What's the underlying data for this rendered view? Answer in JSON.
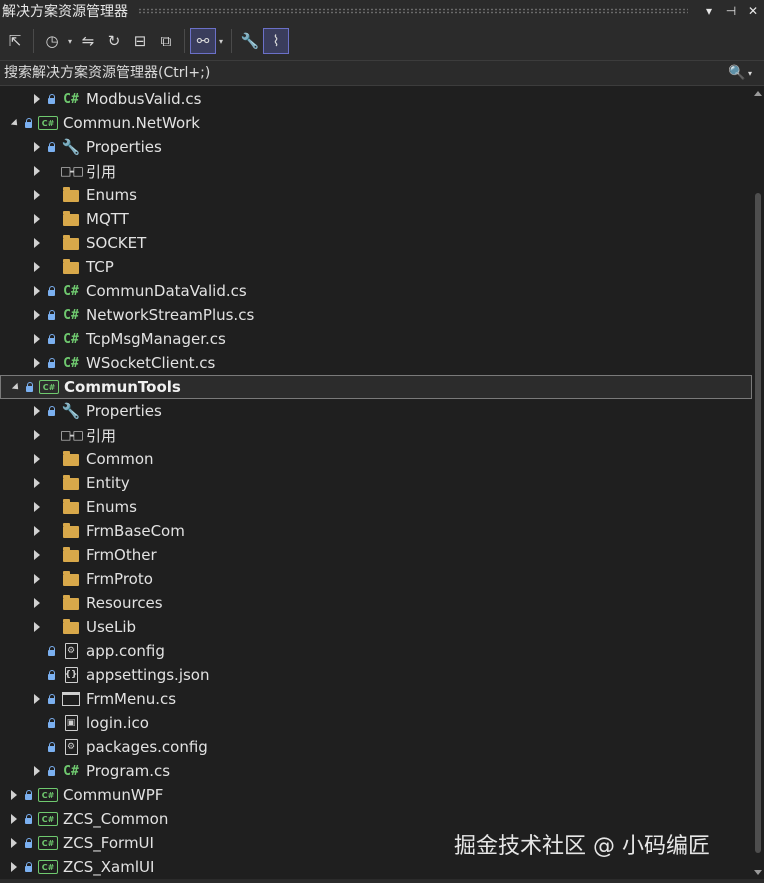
{
  "window": {
    "title": "解决方案资源管理器",
    "dropdown_glyph": "▾",
    "pin_glyph": "⊣",
    "close_glyph": "✕"
  },
  "toolbar": {
    "buttons": [
      {
        "name": "switch-views-button",
        "glyph": "⇱"
      },
      {
        "name": "pending-changes-button",
        "glyph": "◷"
      },
      {
        "name": "sync-button",
        "glyph": "⇋"
      },
      {
        "name": "refresh-button",
        "glyph": "↻"
      },
      {
        "name": "collapse-all-button",
        "glyph": "⊟"
      },
      {
        "name": "show-all-files-button",
        "glyph": "⧉"
      },
      {
        "name": "track-active-item-button",
        "glyph": "⚯"
      },
      {
        "name": "properties-button",
        "glyph": "🔧"
      },
      {
        "name": "preview-button",
        "glyph": "⌇"
      }
    ]
  },
  "search": {
    "placeholder": "搜索解决方案资源管理器(Ctrl+;)"
  },
  "tree": [
    {
      "level": 2,
      "expander": "collapsed",
      "lock": true,
      "icon": "cs",
      "label": "ModbusValid.cs"
    },
    {
      "level": 1,
      "expander": "expanded",
      "lock": true,
      "icon": "proj",
      "label": "Commun.NetWork"
    },
    {
      "level": 2,
      "expander": "collapsed",
      "lock": true,
      "icon": "wrench",
      "label": "Properties"
    },
    {
      "level": 2,
      "expander": "collapsed",
      "lock": false,
      "icon": "ref",
      "label": "引用"
    },
    {
      "level": 2,
      "expander": "collapsed",
      "lock": false,
      "icon": "folder",
      "label": "Enums"
    },
    {
      "level": 2,
      "expander": "collapsed",
      "lock": false,
      "icon": "folder",
      "label": "MQTT"
    },
    {
      "level": 2,
      "expander": "collapsed",
      "lock": false,
      "icon": "folder",
      "label": "SOCKET"
    },
    {
      "level": 2,
      "expander": "collapsed",
      "lock": false,
      "icon": "folder",
      "label": "TCP"
    },
    {
      "level": 2,
      "expander": "collapsed",
      "lock": true,
      "icon": "cs",
      "label": "CommunDataValid.cs"
    },
    {
      "level": 2,
      "expander": "collapsed",
      "lock": true,
      "icon": "cs",
      "label": "NetworkStreamPlus.cs"
    },
    {
      "level": 2,
      "expander": "collapsed",
      "lock": true,
      "icon": "cs",
      "label": "TcpMsgManager.cs"
    },
    {
      "level": 2,
      "expander": "collapsed",
      "lock": true,
      "icon": "cs",
      "label": "WSocketClient.cs"
    },
    {
      "level": 1,
      "expander": "expanded",
      "lock": true,
      "icon": "proj",
      "label": "CommunTools",
      "selected": true
    },
    {
      "level": 2,
      "expander": "collapsed",
      "lock": true,
      "icon": "wrench",
      "label": "Properties"
    },
    {
      "level": 2,
      "expander": "collapsed",
      "lock": false,
      "icon": "ref",
      "label": "引用"
    },
    {
      "level": 2,
      "expander": "collapsed",
      "lock": false,
      "icon": "folder",
      "label": "Common"
    },
    {
      "level": 2,
      "expander": "collapsed",
      "lock": false,
      "icon": "folder",
      "label": "Entity"
    },
    {
      "level": 2,
      "expander": "collapsed",
      "lock": false,
      "icon": "folder",
      "label": "Enums"
    },
    {
      "level": 2,
      "expander": "collapsed",
      "lock": false,
      "icon": "folder",
      "label": "FrmBaseCom"
    },
    {
      "level": 2,
      "expander": "collapsed",
      "lock": false,
      "icon": "folder",
      "label": "FrmOther"
    },
    {
      "level": 2,
      "expander": "collapsed",
      "lock": false,
      "icon": "folder",
      "label": "FrmProto"
    },
    {
      "level": 2,
      "expander": "collapsed",
      "lock": false,
      "icon": "folder",
      "label": "Resources"
    },
    {
      "level": 2,
      "expander": "collapsed",
      "lock": false,
      "icon": "folder",
      "label": "UseLib"
    },
    {
      "level": 2,
      "expander": "none",
      "lock": true,
      "icon": "config",
      "label": "app.config"
    },
    {
      "level": 2,
      "expander": "none",
      "lock": true,
      "icon": "json",
      "label": "appsettings.json"
    },
    {
      "level": 2,
      "expander": "collapsed",
      "lock": true,
      "icon": "form",
      "label": "FrmMenu.cs"
    },
    {
      "level": 2,
      "expander": "none",
      "lock": true,
      "icon": "ico",
      "label": "login.ico"
    },
    {
      "level": 2,
      "expander": "none",
      "lock": true,
      "icon": "config",
      "label": "packages.config"
    },
    {
      "level": 2,
      "expander": "collapsed",
      "lock": true,
      "icon": "cs",
      "label": "Program.cs"
    },
    {
      "level": 1,
      "expander": "collapsed",
      "lock": true,
      "icon": "proj",
      "label": "CommunWPF"
    },
    {
      "level": 1,
      "expander": "collapsed",
      "lock": true,
      "icon": "proj",
      "label": "ZCS_Common"
    },
    {
      "level": 1,
      "expander": "collapsed",
      "lock": true,
      "icon": "proj",
      "label": "ZCS_FormUI"
    },
    {
      "level": 1,
      "expander": "collapsed",
      "lock": true,
      "icon": "proj",
      "label": "ZCS_XamlUI"
    }
  ],
  "icons": {
    "cs": "C#",
    "proj": "C#",
    "wrench": "🔧",
    "ref": "□-□",
    "config": "⚙",
    "json": "{}",
    "ico": "▣",
    "search": "🔍"
  },
  "watermark": "掘金技术社区 @ 小码编匠",
  "colors": {
    "background": "#1f1f1f",
    "csharp_green": "#6fc96f",
    "folder_yellow": "#d8a84a",
    "lock_blue": "#7bb0f0",
    "active_button": "#6b70c8"
  }
}
